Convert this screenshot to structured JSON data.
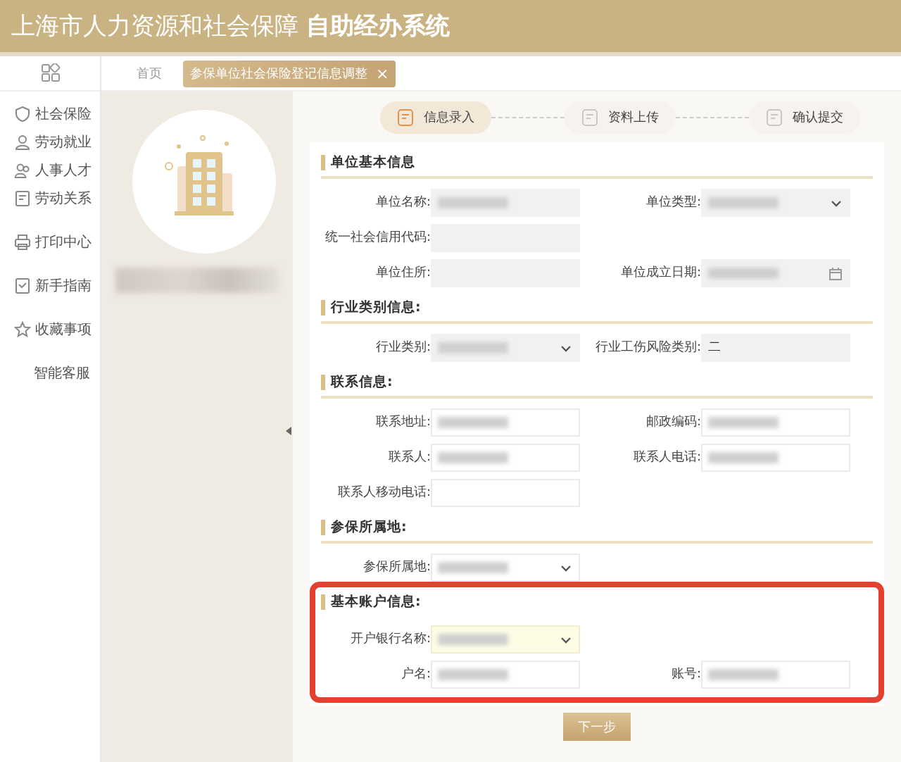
{
  "header": {
    "title": "上海市人力资源和社会保障",
    "title_bold": "自助经办系统"
  },
  "sidebar": {
    "items": [
      {
        "label": "社会保险"
      },
      {
        "label": "劳动就业"
      },
      {
        "label": "人事人才"
      },
      {
        "label": "劳动关系"
      },
      {
        "label": "打印中心"
      },
      {
        "label": "新手指南"
      },
      {
        "label": "收藏事项"
      },
      {
        "label": "智能客服"
      }
    ]
  },
  "tabs": [
    {
      "label": "首页",
      "selected": false
    },
    {
      "label": "参保单位社会保险登记信息调整",
      "selected": true,
      "close": "×"
    }
  ],
  "profile": {
    "name_redacted": true
  },
  "steps": [
    {
      "label": "信息录入",
      "selected": true
    },
    {
      "label": "资料上传",
      "selected": false
    },
    {
      "label": "确认提交",
      "selected": false
    }
  ],
  "sections": [
    {
      "title": "单位基本信息",
      "highlighted": false,
      "rows": [
        [
          {
            "label": "单位名称:",
            "kind": "text",
            "disabled": true,
            "redacted": true
          },
          {
            "label": "单位类型:",
            "kind": "select",
            "disabled": true,
            "redacted": true
          }
        ],
        [
          {
            "label": "统一社会信用代码:",
            "kind": "text",
            "disabled": true,
            "redacted": false
          }
        ],
        [
          {
            "label": "单位住所:",
            "kind": "text",
            "disabled": true,
            "redacted": false
          },
          {
            "label": "单位成立日期:",
            "kind": "date",
            "disabled": true,
            "redacted": true
          }
        ]
      ]
    },
    {
      "title": "行业类别信息:",
      "highlighted": false,
      "rows": [
        [
          {
            "label": "行业类别:",
            "kind": "select",
            "disabled": true,
            "redacted": true
          },
          {
            "label": "行业工伤风险类别:",
            "kind": "text",
            "disabled": true,
            "redacted": false,
            "value": "二"
          }
        ]
      ]
    },
    {
      "title": "联系信息:",
      "highlighted": false,
      "rows": [
        [
          {
            "label": "联系地址:",
            "kind": "text",
            "disabled": false,
            "redacted": true
          },
          {
            "label": "邮政编码:",
            "kind": "text",
            "disabled": false,
            "redacted": true
          }
        ],
        [
          {
            "label": "联系人:",
            "kind": "text",
            "disabled": false,
            "redacted": true
          },
          {
            "label": "联系人电话:",
            "kind": "text",
            "disabled": false,
            "redacted": true
          }
        ],
        [
          {
            "label": "联系人移动电话:",
            "kind": "text",
            "disabled": false,
            "redacted": false
          }
        ]
      ]
    },
    {
      "title": "参保所属地:",
      "highlighted": false,
      "rows": [
        [
          {
            "label": "参保所属地:",
            "kind": "select",
            "disabled": false,
            "redacted": true
          }
        ]
      ]
    },
    {
      "title": "基本账户信息:",
      "highlighted": true,
      "rows": [
        [
          {
            "label": "开户银行名称:",
            "kind": "select",
            "disabled": false,
            "redacted": true,
            "focused": true
          }
        ],
        [
          {
            "label": "户名:",
            "kind": "text",
            "disabled": false,
            "redacted": true
          },
          {
            "label": "账号:",
            "kind": "text",
            "disabled": false,
            "redacted": true
          }
        ]
      ]
    }
  ],
  "next_button": "下一步"
}
